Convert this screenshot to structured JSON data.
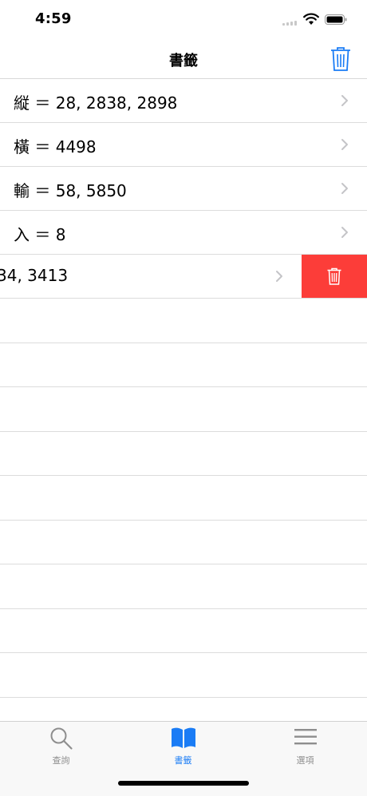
{
  "status_bar": {
    "time": "4:59"
  },
  "nav": {
    "title": "書籤",
    "trash_icon": "trash-icon"
  },
  "rows": [
    {
      "label": "縦 ＝ 28, 2838, 2898"
    },
    {
      "label": "橫 ＝ 4498"
    },
    {
      "label": "輸 ＝ 58, 5850"
    },
    {
      "label": "入 ＝ 8"
    },
    {
      "label": "34, 3413",
      "swiped": true,
      "delete_icon": "trash-icon"
    }
  ],
  "tabs": [
    {
      "label": "查詢",
      "icon": "magnifier-icon",
      "active": false
    },
    {
      "label": "書籤",
      "icon": "book-icon",
      "active": true
    },
    {
      "label": "選項",
      "icon": "menu-icon",
      "active": false
    }
  ],
  "colors": {
    "accent": "#1a7cf5",
    "delete": "#fc3d39",
    "separator": "#dcdcdc"
  }
}
